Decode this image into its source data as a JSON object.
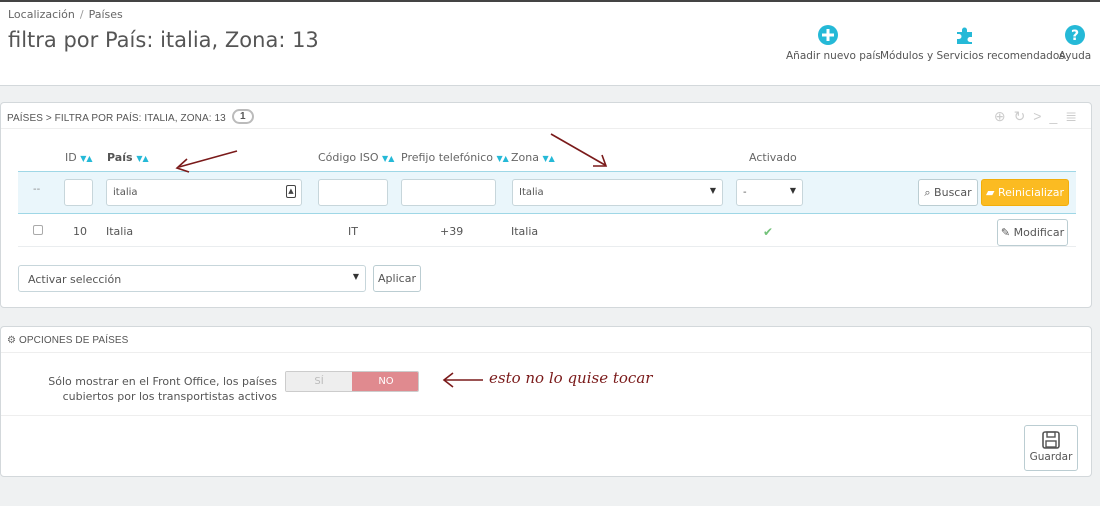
{
  "breadcrumb": [
    "Localización",
    "Países"
  ],
  "breadcrumb_sep": "/",
  "page_title": "filtra por País: italia, Zona: 13",
  "toolbar": {
    "add_country": "Añadir nuevo país",
    "modules": "Módulos y Servicios recomendados",
    "help": "Ayuda"
  },
  "list_panel": {
    "heading": "PAÍSES > FILTRA POR PAÍS: ITALIA, ZONA: 13",
    "count": "1",
    "columns": {
      "id": "ID",
      "country": "País",
      "iso": "Código ISO",
      "phone": "Prefijo telefónico",
      "zone": "Zona",
      "active": "Activado"
    },
    "filters": {
      "bulk_placeholder": "--",
      "country_value": "italia",
      "zone_value": "Italia",
      "active_value": "-",
      "search_label": "Buscar",
      "reset_label": "Reinicializar"
    },
    "rows": [
      {
        "id": "10",
        "country": "Italia",
        "iso": "IT",
        "phone": "+39",
        "zone": "Italia",
        "active": "✔",
        "edit_label": "Modificar"
      }
    ],
    "bulk_action": "Activar selección",
    "apply_label": "Aplicar"
  },
  "options_panel": {
    "heading": "OPCIONES DE PAÍSES",
    "option_label": "Sólo mostrar en el Front Office, los países cubiertos por los transportistas activos",
    "switch_yes": "SÍ",
    "switch_no": "NO",
    "save_label": "Guardar"
  },
  "annotation": "esto no lo quise tocar",
  "colors": {
    "accent": "#25b9d7",
    "orange": "#fbbb22",
    "switch_no": "#e08a8f",
    "check": "#72c279",
    "annotation_arrow": "#7a1a1a"
  }
}
